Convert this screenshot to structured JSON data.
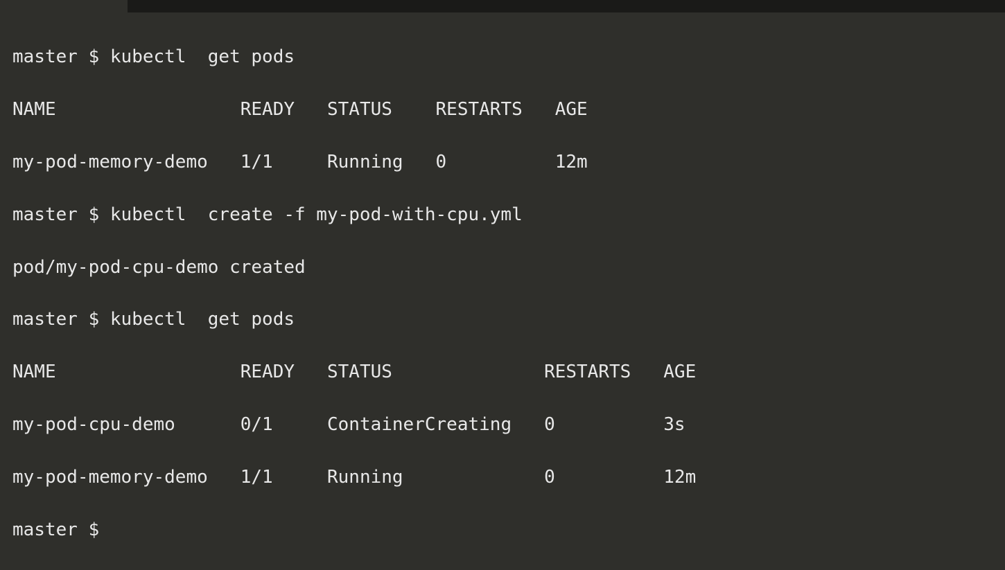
{
  "colors": {
    "bg": "#2f2f2b",
    "fg": "#e8e8e8",
    "top_bar": "#1a1a18"
  },
  "prompt": "master $",
  "commands": {
    "cmd1": "kubectl  get pods",
    "cmd2": "kubectl  create -f my-pod-with-cpu.yml",
    "cmd3": "kubectl  get pods"
  },
  "create_output": "pod/my-pod-cpu-demo created",
  "list1": {
    "headers": {
      "name": "NAME",
      "ready": "READY",
      "status": "STATUS",
      "restarts": "RESTARTS",
      "age": "AGE"
    },
    "rows": [
      {
        "name": "my-pod-memory-demo",
        "ready": "1/1",
        "status": "Running",
        "restarts": "0",
        "age": "12m"
      }
    ]
  },
  "list2": {
    "headers": {
      "name": "NAME",
      "ready": "READY",
      "status": "STATUS",
      "restarts": "RESTARTS",
      "age": "AGE"
    },
    "rows": [
      {
        "name": "my-pod-cpu-demo",
        "ready": "0/1",
        "status": "ContainerCreating",
        "restarts": "0",
        "age": "3s"
      },
      {
        "name": "my-pod-memory-demo",
        "ready": "1/1",
        "status": "Running",
        "restarts": "0",
        "age": "12m"
      }
    ]
  },
  "chart_data": {
    "type": "table",
    "title": "kubectl get pods (second invocation)",
    "columns": [
      "NAME",
      "READY",
      "STATUS",
      "RESTARTS",
      "AGE"
    ],
    "rows": [
      [
        "my-pod-cpu-demo",
        "0/1",
        "ContainerCreating",
        "0",
        "3s"
      ],
      [
        "my-pod-memory-demo",
        "1/1",
        "Running",
        "0",
        "12m"
      ]
    ]
  }
}
